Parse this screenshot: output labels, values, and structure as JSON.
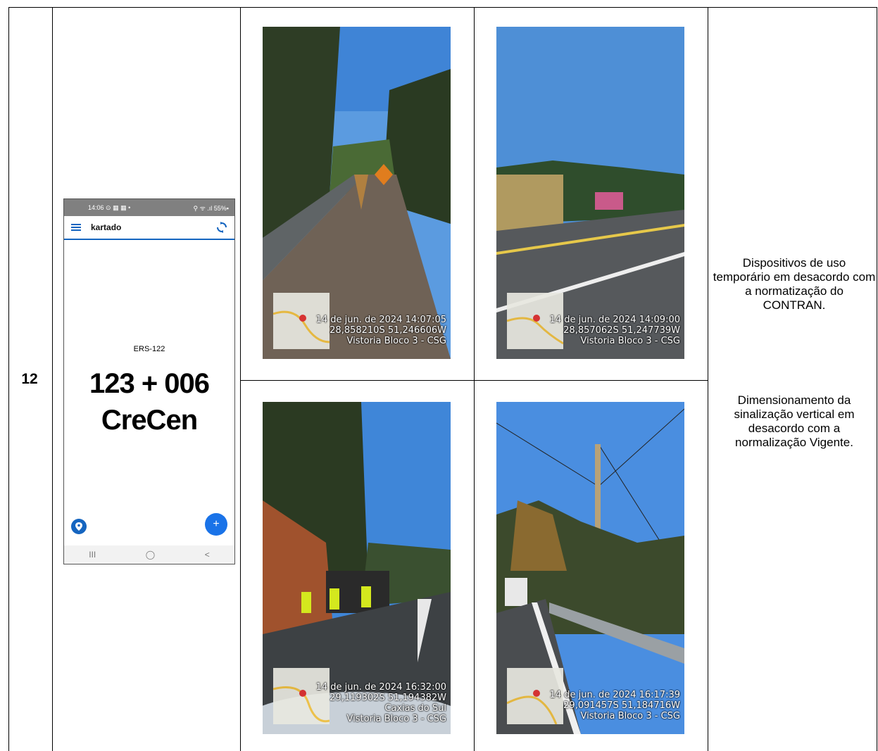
{
  "row_number": "12",
  "phone": {
    "status_time": "14:06",
    "status_icons_left": "⊙ ▦ ▦ •",
    "status_right": "⚲ ᯤ .ıl 55%▪",
    "app_name": "kartado",
    "road_code": "ERS-122",
    "km_value": "123 + 006",
    "direction": "CreCen",
    "nav_buttons": [
      "III",
      "◯",
      "<"
    ],
    "icons": [
      "menu-icon",
      "sync-icon",
      "location-pin-icon",
      "plus-icon"
    ]
  },
  "photos": [
    {
      "date": "14 de jun. de 2024 14:07:05",
      "coords": "28,858210S 51,246606W",
      "location": "",
      "label": "Vistoria Bloco 3 - CSG"
    },
    {
      "date": "14 de jun. de 2024 14:09:00",
      "coords": "28,857062S 51,247739W",
      "location": "",
      "label": "Vistoria Bloco 3 - CSG"
    },
    {
      "date": "14 de jun. de 2024 16:32:00",
      "coords": "29,119302S 51,194382W",
      "location": "Caxias do Sul",
      "label": "Vistoria Bloco 3 - CSG"
    },
    {
      "date": "14 de jun. de 2024 16:17:39",
      "coords": "29,091457S 51,184716W",
      "location": "",
      "label": "Vistoria Bloco 3 - CSG"
    }
  ],
  "descriptions": [
    "Dispositivos de uso temporário em desacordo com a normatização do CONTRAN.",
    "Dimensionamento da sinalização vertical em desacordo com a normalização Vigente."
  ],
  "colors": {
    "accent": "#1565c0",
    "fab": "#1a73e8",
    "status_bar": "#808080"
  }
}
